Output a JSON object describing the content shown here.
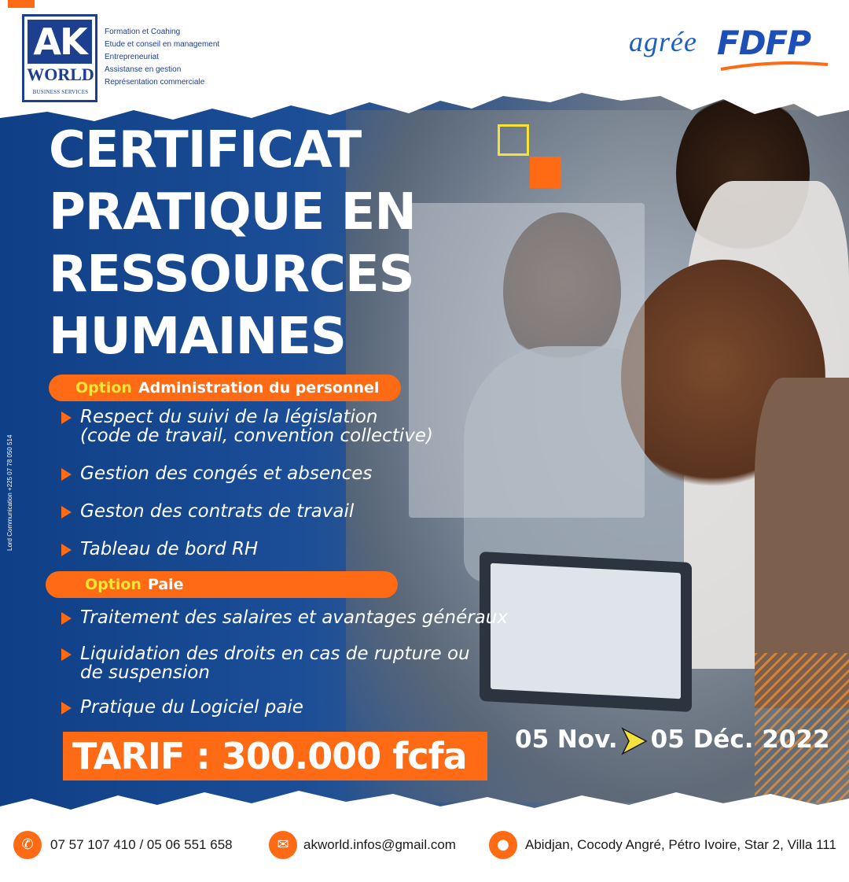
{
  "brand": {
    "logo_main": "AK",
    "logo_world": "WORLD",
    "logo_sub": "BUSINESS SERVICES",
    "services": [
      "Formation et Coahing",
      "Etude et conseil en management",
      "Entrepreneuriat",
      "Assistanse en gestion",
      "Représentation commerciale"
    ],
    "agree": "agrée",
    "fdfp": "FDFP"
  },
  "title_lines": [
    "CERTIFICAT",
    "PRATIQUE EN",
    "RESSOURCES",
    "HUMAINES"
  ],
  "option1": {
    "label": "Option",
    "name": "Administration du personnel",
    "items": [
      [
        "Respect du suivi de la législation",
        "(code de travail, convention collective)"
      ],
      [
        "Gestion des congés et absences"
      ],
      [
        "Geston des contrats de travail"
      ],
      [
        "Tableau de bord RH"
      ]
    ]
  },
  "option2": {
    "label": "Option",
    "name": "Paie",
    "items": [
      [
        "Traitement des salaires et avantages généraux"
      ],
      [
        "Liquidation des droits en cas de rupture ou",
        "de suspension"
      ],
      [
        "Pratique du Logiciel paie"
      ]
    ]
  },
  "tarif": "TARIF : 300.000 fcfa",
  "dates": {
    "start": "05 Nov.",
    "end": "05 Déc. 2022"
  },
  "credit": "Lord Communication +225 07 78 050 514",
  "footer": {
    "phone": "07 57 107 410 /  05 06 551 658",
    "email": "akworld.infos@gmail.com",
    "address": "Abidjan, Cocody Angré, Pétro Ivoire, Star 2, Villa 111"
  },
  "icons": {
    "phone": "phone-icon",
    "email": "envelope-icon",
    "address": "location-pin-icon"
  },
  "colors": {
    "navy": "#1c3f8f",
    "orange": "#ff6a14",
    "yellow": "#f5e23a",
    "white": "#ffffff"
  }
}
